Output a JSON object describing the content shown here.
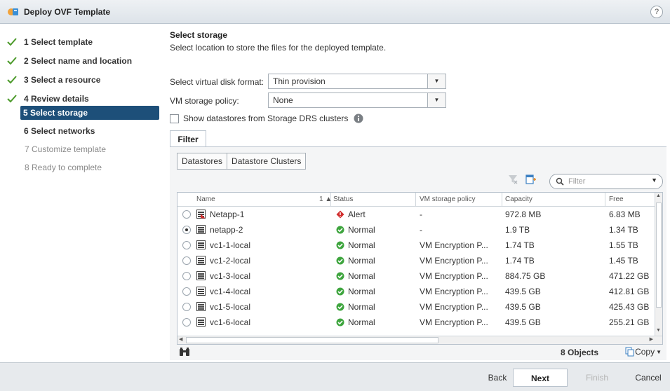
{
  "window": {
    "title": "Deploy OVF Template",
    "help": "?"
  },
  "steps": [
    {
      "label": "1  Select template",
      "state": "done"
    },
    {
      "label": "2  Select name and location",
      "state": "done"
    },
    {
      "label": "3  Select a resource",
      "state": "done"
    },
    {
      "label": "4  Review details",
      "state": "done"
    },
    {
      "label": "5  Select storage",
      "state": "active"
    },
    {
      "label": "6  Select networks",
      "state": "next"
    },
    {
      "label": "7  Customize template",
      "state": "pending"
    },
    {
      "label": "8  Ready to complete",
      "state": "pending"
    }
  ],
  "main": {
    "title": "Select storage",
    "description": "Select location to store the files for the deployed template.",
    "disk_format_label": "Select virtual disk format:",
    "disk_format_value": "Thin provision",
    "policy_label": "VM storage policy:",
    "policy_value": "None",
    "show_drs_label": "Show datastores from Storage DRS clusters",
    "filter_tab": "Filter",
    "seg_datastores": "Datastores",
    "seg_clusters": "Datastore Clusters",
    "filter_placeholder": "Filter"
  },
  "table": {
    "headers": {
      "name": "Name",
      "sort": "1 ▲",
      "status": "Status",
      "policy": "VM storage policy",
      "capacity": "Capacity",
      "free": "Free"
    },
    "rows": [
      {
        "selected": false,
        "name": "Netapp-1",
        "status": "Alert",
        "status_type": "alert",
        "policy": "-",
        "capacity": "972.8  MB",
        "free": "6.83  MB"
      },
      {
        "selected": true,
        "name": "netapp-2",
        "status": "Normal",
        "status_type": "normal",
        "policy": "-",
        "capacity": "1.9  TB",
        "free": "1.34  TB"
      },
      {
        "selected": false,
        "name": "vc1-1-local",
        "status": "Normal",
        "status_type": "normal",
        "policy": "VM Encryption P...",
        "capacity": "1.74  TB",
        "free": "1.55  TB"
      },
      {
        "selected": false,
        "name": "vc1-2-local",
        "status": "Normal",
        "status_type": "normal",
        "policy": "VM Encryption P...",
        "capacity": "1.74  TB",
        "free": "1.45  TB"
      },
      {
        "selected": false,
        "name": "vc1-3-local",
        "status": "Normal",
        "status_type": "normal",
        "policy": "VM Encryption P...",
        "capacity": "884.75  GB",
        "free": "471.22  GB"
      },
      {
        "selected": false,
        "name": "vc1-4-local",
        "status": "Normal",
        "status_type": "normal",
        "policy": "VM Encryption P...",
        "capacity": "439.5  GB",
        "free": "412.81  GB"
      },
      {
        "selected": false,
        "name": "vc1-5-local",
        "status": "Normal",
        "status_type": "normal",
        "policy": "VM Encryption P...",
        "capacity": "439.5  GB",
        "free": "425.43  GB"
      },
      {
        "selected": false,
        "name": "vc1-6-local",
        "status": "Normal",
        "status_type": "normal",
        "policy": "VM Encryption P...",
        "capacity": "439.5  GB",
        "free": "255.21  GB"
      }
    ],
    "object_count": "8 Objects",
    "copy_label": "Copy"
  },
  "footer": {
    "back": "Back",
    "next": "Next",
    "finish": "Finish",
    "cancel": "Cancel"
  },
  "colors": {
    "accent": "#1d4f79",
    "check": "#4c9a2a",
    "alert": "#d12d2d",
    "normal": "#3ea53e"
  }
}
